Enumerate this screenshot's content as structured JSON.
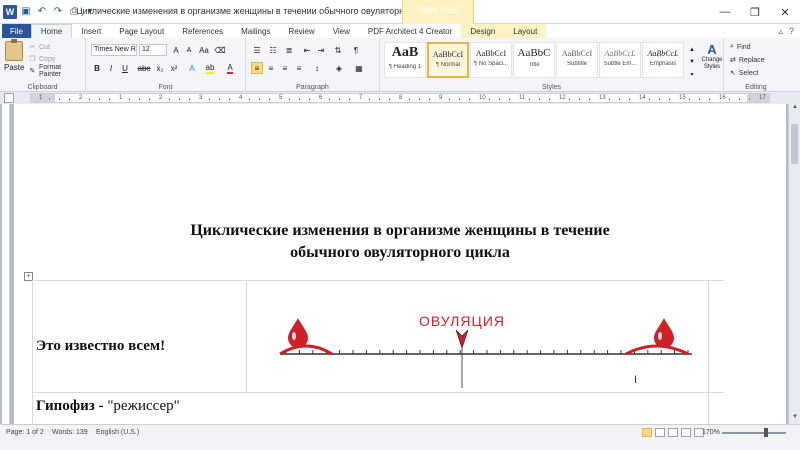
{
  "app": {
    "title": "Циклические изменения в организме женщины в течении обычного овуляторного цикла.doc [...",
    "context_tab_header": "Table Tools",
    "window_buttons": [
      "—",
      "❐",
      "✕"
    ]
  },
  "qat": {
    "icons": [
      "save-icon",
      "undo-icon",
      "redo-icon",
      "print-icon",
      "customize-icon"
    ]
  },
  "tabs": [
    {
      "label": "File"
    },
    {
      "label": "Home"
    },
    {
      "label": "Insert"
    },
    {
      "label": "Page Layout"
    },
    {
      "label": "References"
    },
    {
      "label": "Mailings"
    },
    {
      "label": "Review"
    },
    {
      "label": "View"
    },
    {
      "label": "PDF Architect 4 Creator"
    },
    {
      "label": "Design"
    },
    {
      "label": "Layout"
    }
  ],
  "ribbon": {
    "clipboard": {
      "paste": "Paste",
      "cut": "Cut",
      "copy": "Copy",
      "format_painter": "Format Painter",
      "label": "Clipboard"
    },
    "font": {
      "font_name": "Times New Ro",
      "font_size": "12",
      "label": "Font"
    },
    "paragraph": {
      "label": "Paragraph"
    },
    "styles": {
      "label": "Styles",
      "tiles": [
        {
          "sample": "AaB",
          "name": "¶ Heading 1"
        },
        {
          "sample": "AaBbCcI",
          "name": "¶ Normal"
        },
        {
          "sample": "AaBbCcI",
          "name": "¶ No Spaci..."
        },
        {
          "sample": "AaBbC",
          "name": "Title"
        },
        {
          "sample": "AaBbCcI",
          "name": "Subtitle"
        },
        {
          "sample": "AaBbCcL",
          "name": "Subtle Em..."
        },
        {
          "sample": "AaBbCcL",
          "name": "Emphasis"
        }
      ],
      "change_styles": "Change Styles"
    },
    "editing": {
      "find": "Find",
      "replace": "Replace",
      "select": "Select",
      "label": "Editing"
    }
  },
  "ruler": {
    "numbers": [
      "1",
      "2",
      "1",
      "2",
      "3",
      "4",
      "5",
      "6",
      "7",
      "8",
      "9",
      "10",
      "11",
      "12",
      "13",
      "14",
      "15",
      "16",
      "17"
    ]
  },
  "document": {
    "title_line1": "Циклические изменения в организме женщины в течение",
    "title_line2": "обычного овуляторного цикла",
    "row1_text": "Это известно всем!",
    "row2_bold": "Гипофиз - ",
    "row2_normal": "\"режиссер\"",
    "figure_label": "ОВУЛЯЦИЯ",
    "accent_red": "#d01f27"
  },
  "status": {
    "page": "Page: 1 of 2",
    "words": "Words: 139",
    "language": "English (U.S.)",
    "zoom": "170%"
  }
}
